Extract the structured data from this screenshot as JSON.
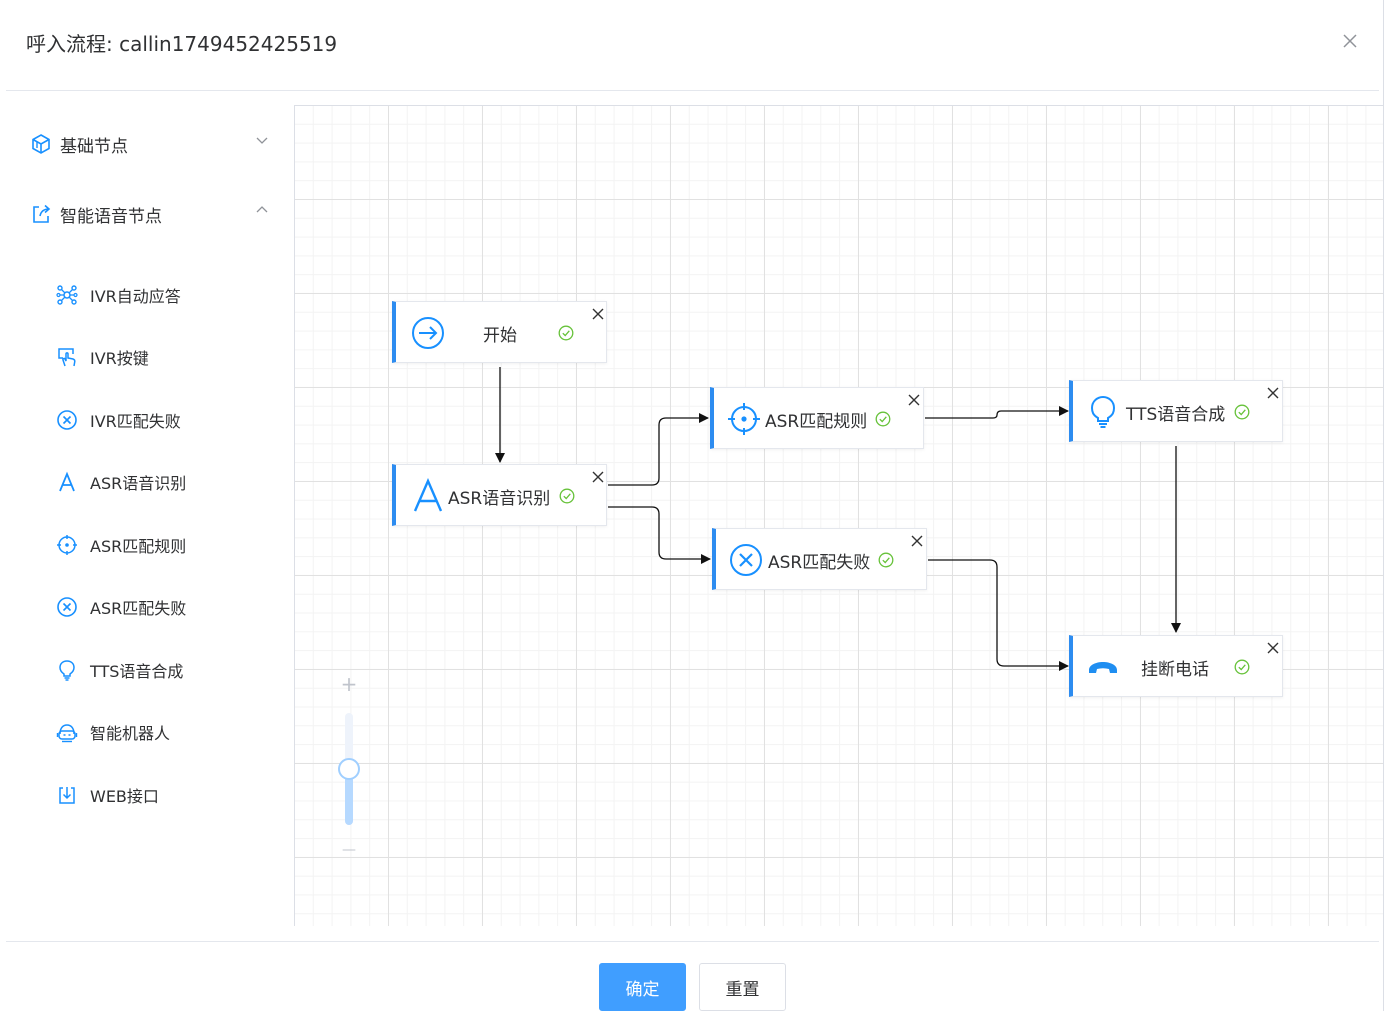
{
  "dialog": {
    "title": "呼入流程: callin1749452425519"
  },
  "sidebar": {
    "groups": [
      {
        "label": "基础节点",
        "icon": "cube-icon",
        "expanded": false
      },
      {
        "label": "智能语音节点",
        "icon": "share-icon",
        "expanded": true
      }
    ],
    "items": [
      {
        "label": "IVR自动应答",
        "icon": "network-icon"
      },
      {
        "label": "IVR按键",
        "icon": "touch-icon"
      },
      {
        "label": "IVR匹配失败",
        "icon": "cross-circle-icon"
      },
      {
        "label": "ASR语音识别",
        "icon": "letter-a-icon"
      },
      {
        "label": "ASR匹配规则",
        "icon": "target-icon"
      },
      {
        "label": "ASR匹配失败",
        "icon": "cross-circle-icon"
      },
      {
        "label": "TTS语音合成",
        "icon": "bulb-icon"
      },
      {
        "label": "智能机器人",
        "icon": "robot-icon"
      },
      {
        "label": "WEB接口",
        "icon": "download-box-icon"
      }
    ]
  },
  "flow": {
    "nodes": [
      {
        "id": "start",
        "label": "开始",
        "icon": "arrow-circle-icon"
      },
      {
        "id": "asr",
        "label": "ASR语音识别",
        "icon": "letter-a-icon"
      },
      {
        "id": "match",
        "label": "ASR匹配规则",
        "icon": "target-icon"
      },
      {
        "id": "fail",
        "label": "ASR匹配失败",
        "icon": "cross-circle-icon"
      },
      {
        "id": "tts",
        "label": "TTS语音合成",
        "icon": "bulb-icon"
      },
      {
        "id": "hangup",
        "label": "挂断电话",
        "icon": "phone-hangup-icon"
      }
    ],
    "edges": [
      {
        "from": "开始",
        "to": "ASR语音识别"
      },
      {
        "from": "ASR语音识别",
        "to": "ASR匹配规则"
      },
      {
        "from": "ASR语音识别",
        "to": "ASR匹配失败"
      },
      {
        "from": "ASR匹配规则",
        "to": "TTS语音合成"
      },
      {
        "from": "TTS语音合成",
        "to": "挂断电话"
      },
      {
        "from": "ASR匹配失败",
        "to": "挂断电话"
      }
    ]
  },
  "zoom": {
    "plus": "+",
    "minus": "—",
    "level": 0.45
  },
  "footer": {
    "confirm_label": "确定",
    "reset_label": "重置"
  },
  "colors": {
    "accent": "#409eff",
    "node_border": "#2d8cf0",
    "icon": "#1890ff",
    "check": "#67c23a",
    "phone": "#1f8ef1"
  }
}
